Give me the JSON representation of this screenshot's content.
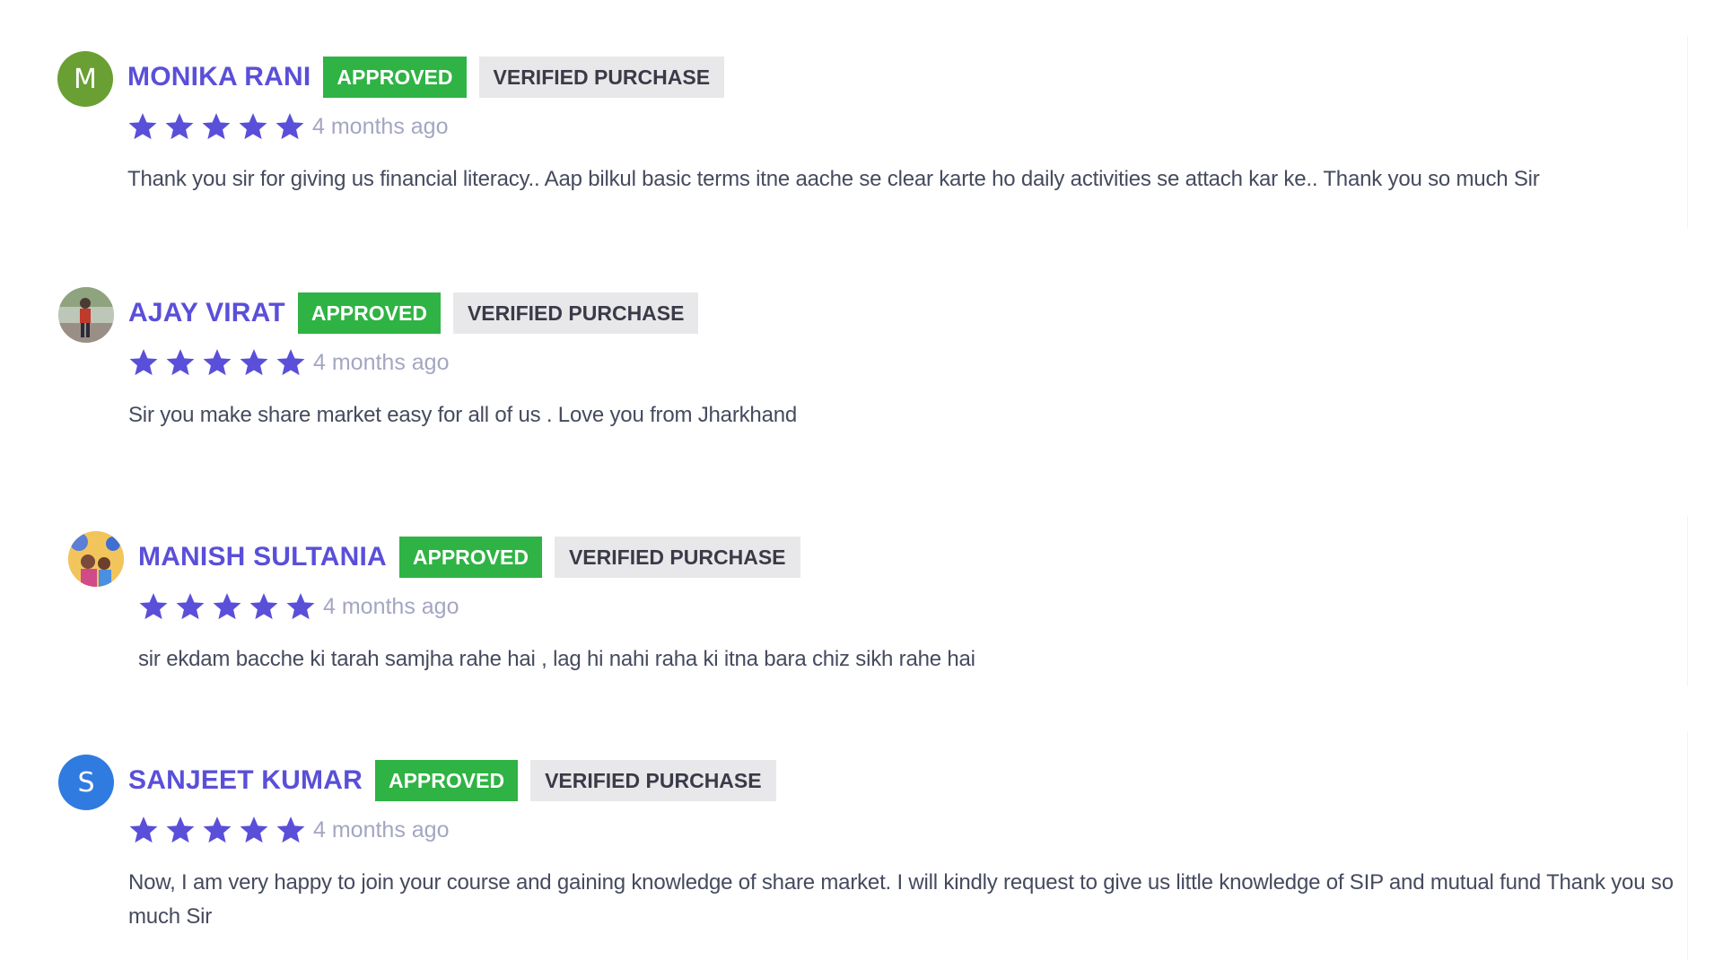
{
  "reviews": [
    {
      "avatar": {
        "type": "initial",
        "letter": "M",
        "color": "#6a9f34"
      },
      "name": "MONIKA RANI",
      "approved": "APPROVED",
      "verified": "VERIFIED PURCHASE",
      "rating": 5,
      "date": "4 months ago",
      "text": "Thank you sir for giving us financial literacy.. Aap bilkul basic terms itne aache se clear karte ho daily activities se attach kar ke.. Thank you so much Sir"
    },
    {
      "avatar": {
        "type": "photo"
      },
      "name": "AJAY VIRAT",
      "approved": "APPROVED",
      "verified": "VERIFIED PURCHASE",
      "rating": 5,
      "date": "4 months ago",
      "text": "Sir you make share market easy for all of us . Love you from Jharkhand"
    },
    {
      "avatar": {
        "type": "photo"
      },
      "name": "MANISH SULTANIA",
      "approved": "APPROVED",
      "verified": "VERIFIED PURCHASE",
      "rating": 5,
      "date": "4 months ago",
      "text": "sir ekdam bacche ki tarah samjha rahe hai , lag hi nahi raha ki itna bara chiz sikh rahe hai"
    },
    {
      "avatar": {
        "type": "initial",
        "letter": "S",
        "color": "#2f7be0"
      },
      "name": "SANJEET KUMAR",
      "approved": "APPROVED",
      "verified": "VERIFIED PURCHASE",
      "rating": 5,
      "date": "4 months ago",
      "text": "Now, I am very happy to join your course and gaining knowledge of share market. I will kindly request to give us little knowledge of SIP and mutual fund Thank you so much Sir"
    }
  ],
  "colors": {
    "name": "#5a4fd9",
    "star": "#5a4fd9",
    "approved_bg": "#2fb344",
    "verified_bg": "#e8e8ea",
    "date": "#a4a6c2",
    "text": "#454a5e"
  },
  "icons": {
    "star": "star-icon"
  }
}
